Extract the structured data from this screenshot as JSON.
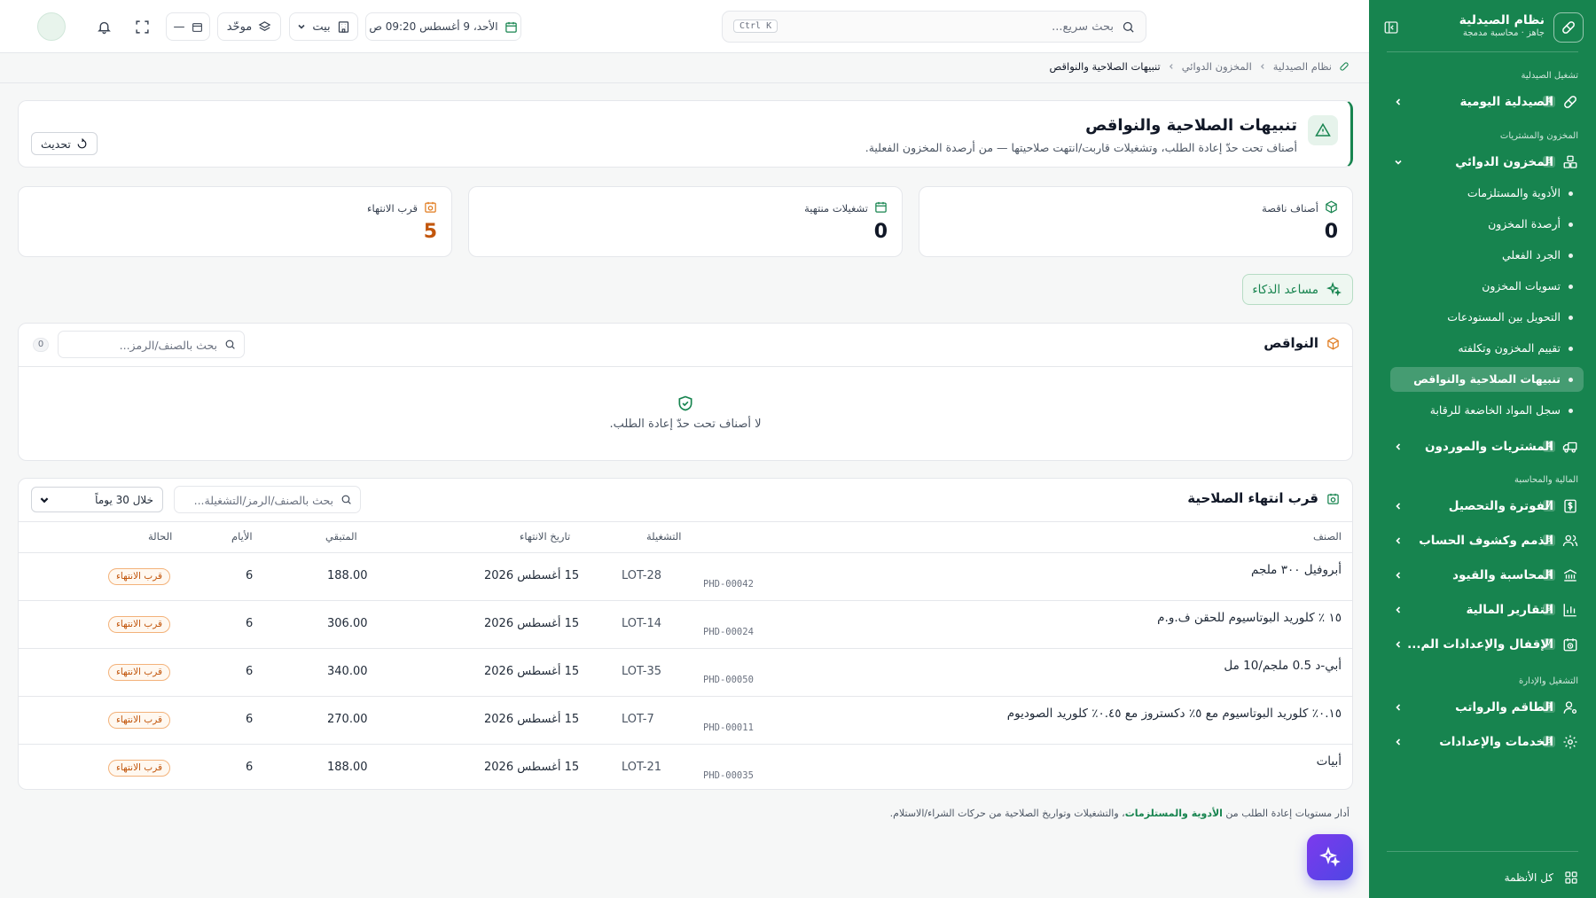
{
  "sidebar": {
    "brand_title": "نظام الصيدلية",
    "brand_subtitle": "جاهز · محاسبة مدمجة",
    "section_ops": "تشغيل الصيدلية",
    "section_inventory": "المخزون والمشتريات",
    "section_finance": "المالية والمحاسبة",
    "section_admin": "التشغيل والإدارة",
    "items": [
      {
        "label": "الصيدلية اليومية",
        "count": "4"
      },
      {
        "label": "المخزون الدوائي",
        "count": "8"
      },
      {
        "label": "المشتريات والموردون",
        "count": "4"
      },
      {
        "label": "الفوترة والتحصيل",
        "count": "7"
      },
      {
        "label": "الذمم وكشوف الحساب",
        "count": "3"
      },
      {
        "label": "المحاسبة والقيود",
        "count": "4"
      },
      {
        "label": "التقارير المالية",
        "count": "9"
      },
      {
        "label": "الإقفال والإعدادات الم...",
        "count": "7"
      },
      {
        "label": "الطاقم والرواتب",
        "count": "9"
      },
      {
        "label": "الخدمات والإعدادات",
        "count": "3"
      }
    ],
    "subitems": [
      "الأدوية والمستلزمات",
      "أرصدة المخزون",
      "الجرد الفعلي",
      "تسويات المخزون",
      "التحويل بين المستودعات",
      "تقييم المخزون وتكلفته",
      "تنبيهات الصلاحية والنواقص",
      "سجل المواد الخاضعة للرقابة"
    ],
    "footer_label": "كل الأنظمة"
  },
  "topbar": {
    "search_placeholder": "بحث سريع...",
    "shortcut": "Ctrl K",
    "datetime": "الأحد، 9 أغسطس  09:20 ص",
    "branch": "بيت",
    "mode": "موحّد",
    "dash": "—"
  },
  "breadcrumb": {
    "root": "نظام الصيدلية",
    "section": "المخزون الدوائي",
    "current": "تنبيهات الصلاحية والنواقص"
  },
  "header": {
    "title": "تنبيهات الصلاحية والنواقص",
    "subtitle": "أصناف تحت حدّ إعادة الطلب، وتشغيلات قاربت/انتهت صلاحيتها — من أرصدة المخزون الفعلية.",
    "refresh_label": "تحديث"
  },
  "stats": [
    {
      "label": "أصناف ناقصة",
      "value": "0"
    },
    {
      "label": "تشغيلات منتهية",
      "value": "0"
    },
    {
      "label": "قرب الانتهاء",
      "value": "5"
    }
  ],
  "ai_button_label": "مساعد الذكاء",
  "shortages": {
    "title": "النواقص",
    "search_placeholder": "بحث بالصنف/الرمز...",
    "count": "0",
    "empty_text": "لا أصناف تحت حدّ إعادة الطلب."
  },
  "expiring": {
    "title": "قرب انتهاء الصلاحية",
    "search_placeholder": "بحث بالصنف/الرمز/التشغيلة...",
    "range": "خلال 30 يوماً",
    "columns": {
      "item": "الصنف",
      "batch": "التشغيلة",
      "expiry": "تاريخ الانتهاء",
      "remaining": "المتبقي",
      "days": "الأيام",
      "status": "الحالة"
    },
    "rows": [
      {
        "name": "أبروفيل ٣٠٠ ملجم",
        "code": "PHD-00042",
        "batch": "LOT-28",
        "expiry": "15 أغسطس 2026",
        "remaining": "188.00",
        "days": "6",
        "status": "قرب الانتهاء"
      },
      {
        "name": "١٥ ٪ كلوريد البوتاسيوم للحقن ف.و.م",
        "code": "PHD-00024",
        "batch": "LOT-14",
        "expiry": "15 أغسطس 2026",
        "remaining": "306.00",
        "days": "6",
        "status": "قرب الانتهاء"
      },
      {
        "name": "أبي-د 0.5 ملجم/10 مل",
        "code": "PHD-00050",
        "batch": "LOT-35",
        "expiry": "15 أغسطس 2026",
        "remaining": "340.00",
        "days": "6",
        "status": "قرب الانتهاء"
      },
      {
        "name": "٠.١٥٪ كلوريد البوتاسيوم مع ٥٪ دكستروز مع ٠.٤٥٪ كلوريد الصوديوم",
        "code": "PHD-00011",
        "batch": "LOT-7",
        "expiry": "15 أغسطس 2026",
        "remaining": "270.00",
        "days": "6",
        "status": "قرب الانتهاء"
      },
      {
        "name": "أبيات",
        "code": "PHD-00035",
        "batch": "LOT-21",
        "expiry": "15 أغسطس 2026",
        "remaining": "188.00",
        "days": "6",
        "status": "قرب الانتهاء"
      }
    ]
  },
  "footnote": {
    "before": "أدار مستويات إعادة الطلب من ",
    "link": "الأدوية والمستلزمات",
    "after": "، والتشغيلات وتواريخ الصلاحية من حركات الشراء/الاستلام."
  },
  "colors": {
    "brand": "#17844f",
    "warning": "#c2560c",
    "fab": "#6d28d9"
  }
}
